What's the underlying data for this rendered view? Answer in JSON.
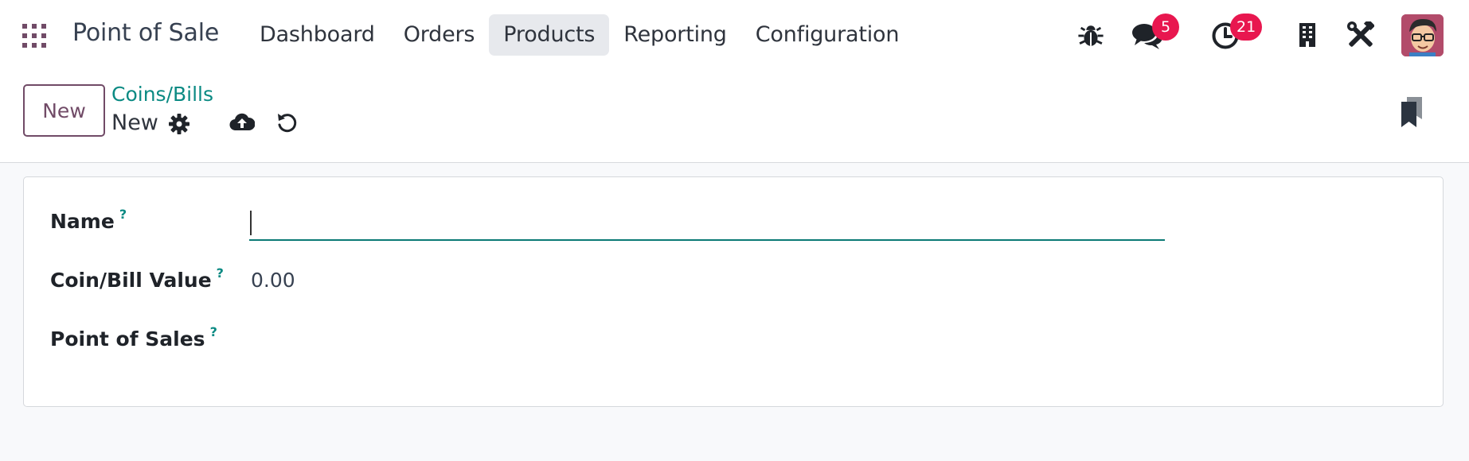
{
  "navbar": {
    "apps_icon": "apps-grid-icon",
    "brand": "Point of Sale",
    "menu": [
      {
        "label": "Dashboard",
        "active": false
      },
      {
        "label": "Orders",
        "active": false
      },
      {
        "label": "Products",
        "active": true
      },
      {
        "label": "Reporting",
        "active": false
      },
      {
        "label": "Configuration",
        "active": false
      }
    ],
    "systray": {
      "debug_icon": "bug-icon",
      "messages_icon": "chat-icon",
      "messages_count": "5",
      "activities_icon": "clock-icon",
      "activities_count": "21",
      "company_icon": "building-icon",
      "settings_icon": "tools-icon",
      "avatar_icon": "user-avatar"
    }
  },
  "control_panel": {
    "new_button": "New",
    "breadcrumb_parent": "Coins/Bills",
    "breadcrumb_current": "New",
    "gear_icon": "gear-icon",
    "save_icon": "cloud-upload-icon",
    "discard_icon": "undo-icon",
    "bookmark_icon": "bookmark-icon"
  },
  "form": {
    "name_label": "Name",
    "name_value": "",
    "value_label": "Coin/Bill Value",
    "value_value": "0.00",
    "pos_label": "Point of Sales",
    "help_mark": "?"
  },
  "colors": {
    "brand_purple": "#714b67",
    "link_teal": "#0b8a83",
    "badge_red": "#e8174f",
    "active_menu_bg": "#e7e9ed",
    "page_bg": "#f8f9fb"
  }
}
